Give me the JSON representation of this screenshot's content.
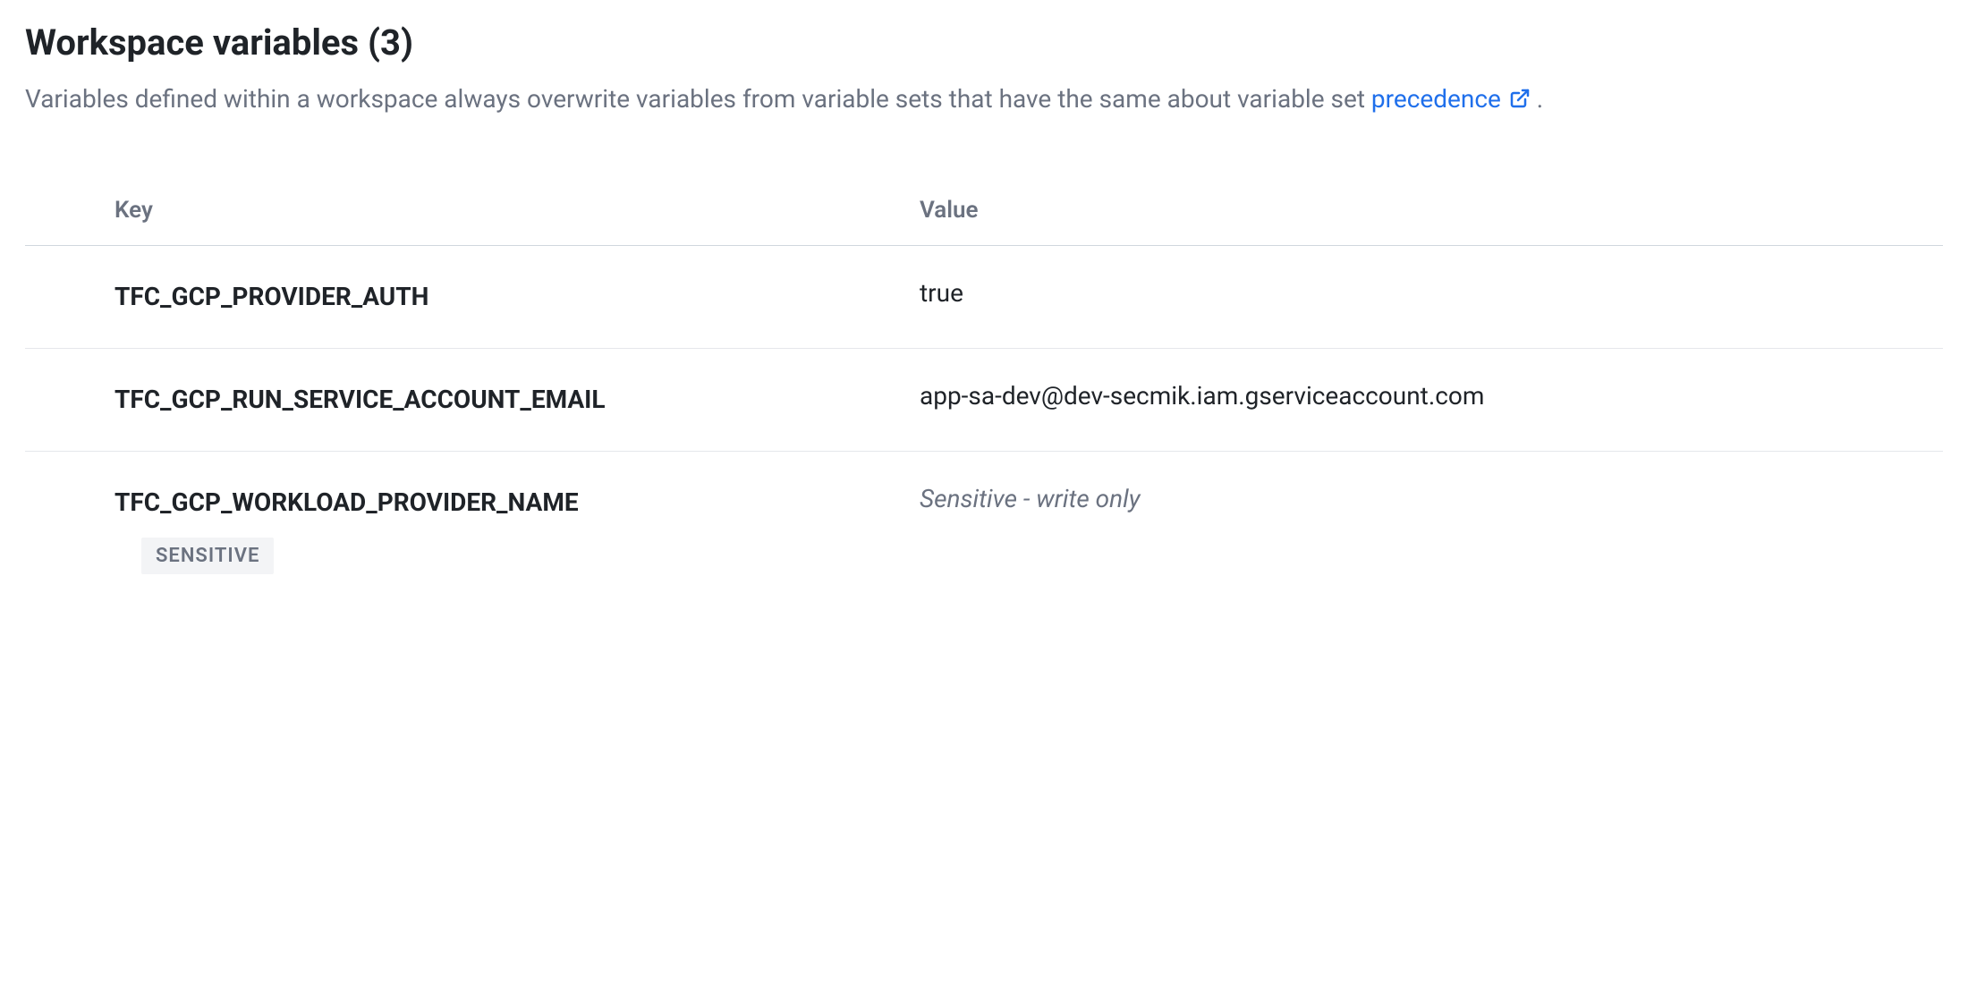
{
  "header": {
    "title_prefix": "Workspace variables",
    "count": 3,
    "description_pre": "Variables defined within a workspace always overwrite variables from variable sets that have the same about variable set ",
    "link_text": "precedence",
    "description_post": "."
  },
  "table": {
    "columns": {
      "key": "Key",
      "value": "Value"
    },
    "rows": [
      {
        "key": "TFC_GCP_PROVIDER_AUTH",
        "value": "true",
        "sensitive": false
      },
      {
        "key": "TFC_GCP_RUN_SERVICE_ACCOUNT_EMAIL",
        "value": "app-sa-dev@dev-secmik.iam.gserviceaccount.com",
        "sensitive": false
      },
      {
        "key": "TFC_GCP_WORKLOAD_PROVIDER_NAME",
        "value": "Sensitive - write only",
        "sensitive": true,
        "badge": "SENSITIVE"
      }
    ]
  }
}
